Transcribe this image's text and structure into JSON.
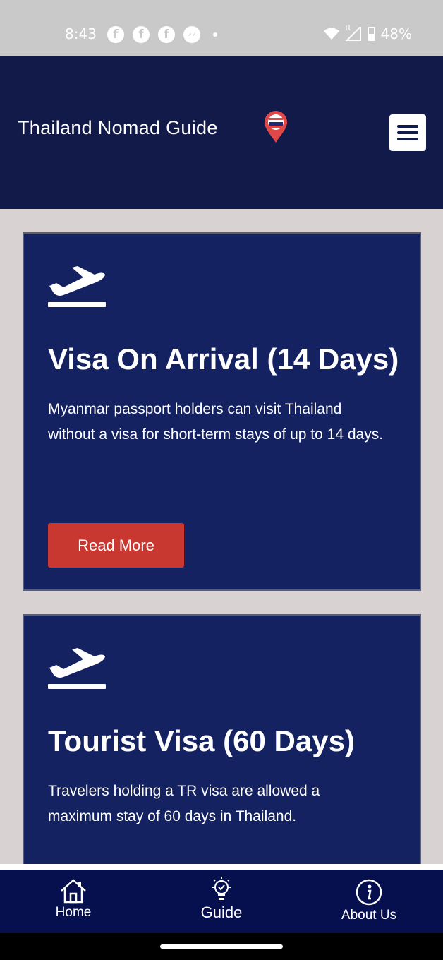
{
  "status_bar": {
    "time": "8:43",
    "battery": "48%",
    "notification_icons": [
      "facebook-icon",
      "facebook-icon",
      "facebook-icon",
      "messenger-icon"
    ],
    "network_label": "R"
  },
  "header": {
    "logo_text": "Thailand Nomad Guide",
    "background": "#111a48"
  },
  "cards": [
    {
      "title": "Visa On Arrival (14 Days)",
      "description": "Myanmar passport holders can visit Thailand without a visa for short-term stays of up to 14 days.",
      "button_label": "Read More"
    },
    {
      "title": "Tourist Visa (60 Days)",
      "description": "Travelers holding a TR visa are allowed a maximum stay of 60 days in Thailand."
    }
  ],
  "bottom_nav": {
    "items": [
      {
        "label": "Home",
        "icon": "home-icon"
      },
      {
        "label": "Guide",
        "icon": "lightbulb-icon"
      },
      {
        "label": "About Us",
        "icon": "info-icon"
      }
    ]
  },
  "colors": {
    "card_bg": "#142262",
    "button_bg": "#c93830",
    "nav_bg": "#07104f"
  }
}
